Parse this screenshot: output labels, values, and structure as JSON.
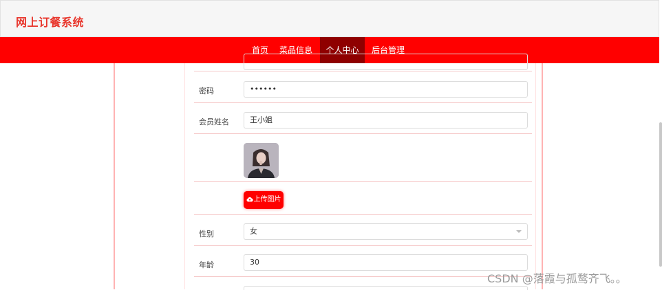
{
  "app": {
    "title": "网上订餐系统"
  },
  "nav": {
    "items": [
      {
        "label": "首页"
      },
      {
        "label": "菜品信息"
      },
      {
        "label": "个人中心"
      },
      {
        "label": "后台管理"
      }
    ],
    "active_index": 2
  },
  "form": {
    "password": {
      "label": "密码",
      "value": "••••••"
    },
    "name": {
      "label": "会员姓名",
      "value": "王小姐"
    },
    "avatar": {
      "icon": "avatar-photo"
    },
    "upload": {
      "label": "上传图片",
      "icon": "cloud-upload-icon"
    },
    "gender": {
      "label": "性别",
      "value": "女"
    },
    "age": {
      "label": "年龄",
      "value": "30"
    }
  },
  "watermark": "CSDN @落霞与孤鹜齐飞。。",
  "colors": {
    "brand": "#ff0000",
    "nav_active": "#8f0000",
    "title": "#e8352b"
  }
}
